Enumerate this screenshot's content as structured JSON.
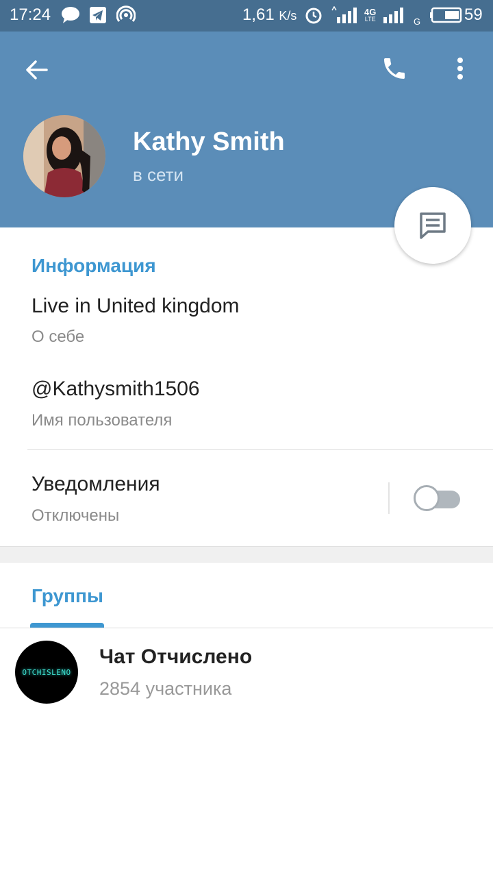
{
  "status_bar": {
    "time": "17:24",
    "net_speed": "1,61",
    "net_speed_unit": "K/s",
    "lte_label": "4G",
    "lte_sub": "LTE",
    "g_label": "G",
    "battery": "59",
    "icons": [
      "message-bubble-icon",
      "telegram-icon",
      "hotspot-icon",
      "alarm-icon",
      "signal-icon",
      "signal-icon",
      "battery-icon"
    ]
  },
  "header": {
    "name": "Kathy Smith",
    "status": "в сети"
  },
  "info": {
    "title": "Информация",
    "bio": "Live in United kingdom",
    "bio_label": "О себе",
    "username": "@Kathysmith1506",
    "username_label": "Имя пользователя",
    "notifications": "Уведомления",
    "notifications_state": "Отключены",
    "notifications_enabled": false
  },
  "groups": {
    "title": "Группы",
    "items": [
      {
        "name": "Чат Отчислено",
        "members": "2854 участника",
        "avatar_text": "OTCHISLENO"
      }
    ]
  },
  "colors": {
    "header": "#5b8db8",
    "status_bar": "#466e90",
    "accent": "#3e97d1"
  }
}
